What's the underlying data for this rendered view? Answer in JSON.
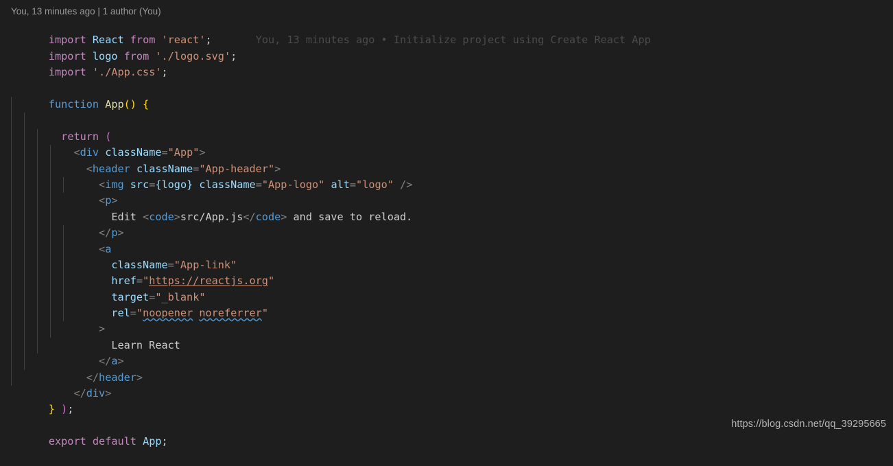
{
  "editor": {
    "background": "#1e1e1e",
    "foreground": "#cccccc",
    "font_size_px": 15,
    "line_height_px": 23,
    "language": "javascriptreact",
    "file_implied": "src/App.js"
  },
  "codelens": {
    "text": "You, 13 minutes ago | 1 author (You)",
    "author": "You",
    "relative_time": "13 minutes ago",
    "authors_label": "1 author (You)"
  },
  "inline_blame": {
    "text": "You, 13 minutes ago • Initialize project using Create React App",
    "author": "You",
    "relative_time": "13 minutes ago",
    "separator": "•",
    "commit_message": "Initialize project using Create React App",
    "on_line": 1,
    "color": "#4b4b4b"
  },
  "colors": {
    "keyword": "#c586c0",
    "control": "#569cd6",
    "identifier": "#9cdcfe",
    "function": "#dcdcaa",
    "string": "#ce9178",
    "tag": "#569cd6",
    "bracket": "#808080",
    "bracket_pair_1": "#ffd700",
    "bracket_pair_2": "#da70d6",
    "text": "#cccccc",
    "indent_guide": "#404040",
    "spellcheck_squiggle": "#4e94ce"
  },
  "watermark": {
    "text": "https://blog.csdn.net/qq_39295665"
  },
  "code_lines": [
    {
      "n": 1,
      "indent": 0,
      "text": "import React from 'react';"
    },
    {
      "n": 2,
      "indent": 0,
      "text": "import logo from './logo.svg';"
    },
    {
      "n": 3,
      "indent": 0,
      "text": "import './App.css';"
    },
    {
      "n": 4,
      "indent": 0,
      "text": ""
    },
    {
      "n": 5,
      "indent": 0,
      "text": "function App() {"
    },
    {
      "n": 6,
      "indent": 1,
      "text": "  return ("
    },
    {
      "n": 7,
      "indent": 2,
      "text": "    <div className=\"App\">"
    },
    {
      "n": 8,
      "indent": 3,
      "text": "      <header className=\"App-header\">"
    },
    {
      "n": 9,
      "indent": 4,
      "text": "        <img src={logo} className=\"App-logo\" alt=\"logo\" />"
    },
    {
      "n": 10,
      "indent": 4,
      "text": "        <p>"
    },
    {
      "n": 11,
      "indent": 5,
      "text": "          Edit <code>src/App.js</code> and save to reload."
    },
    {
      "n": 12,
      "indent": 4,
      "text": "        </p>"
    },
    {
      "n": 13,
      "indent": 4,
      "text": "        <a"
    },
    {
      "n": 14,
      "indent": 5,
      "text": "          className=\"App-link\""
    },
    {
      "n": 15,
      "indent": 5,
      "text": "          href=\"https://reactjs.org\""
    },
    {
      "n": 16,
      "indent": 5,
      "text": "          target=\"_blank\""
    },
    {
      "n": 17,
      "indent": 5,
      "text": "          rel=\"noopener noreferrer\""
    },
    {
      "n": 18,
      "indent": 5,
      "text": "        >"
    },
    {
      "n": 19,
      "indent": 5,
      "text": "          Learn React"
    },
    {
      "n": 20,
      "indent": 4,
      "text": "        </a>"
    },
    {
      "n": 21,
      "indent": 3,
      "text": "      </header>"
    },
    {
      "n": 22,
      "indent": 2,
      "text": "    </div>"
    },
    {
      "n": 23,
      "indent": 1,
      "text": "  );"
    },
    {
      "n": 24,
      "indent": 0,
      "text": "}"
    },
    {
      "n": 25,
      "indent": 0,
      "text": ""
    },
    {
      "n": 26,
      "indent": 0,
      "text": "export default App;"
    }
  ],
  "annotations": {
    "underlined_link": "https://reactjs.org",
    "spellcheck_words": [
      "noopener",
      "noreferrer"
    ]
  }
}
